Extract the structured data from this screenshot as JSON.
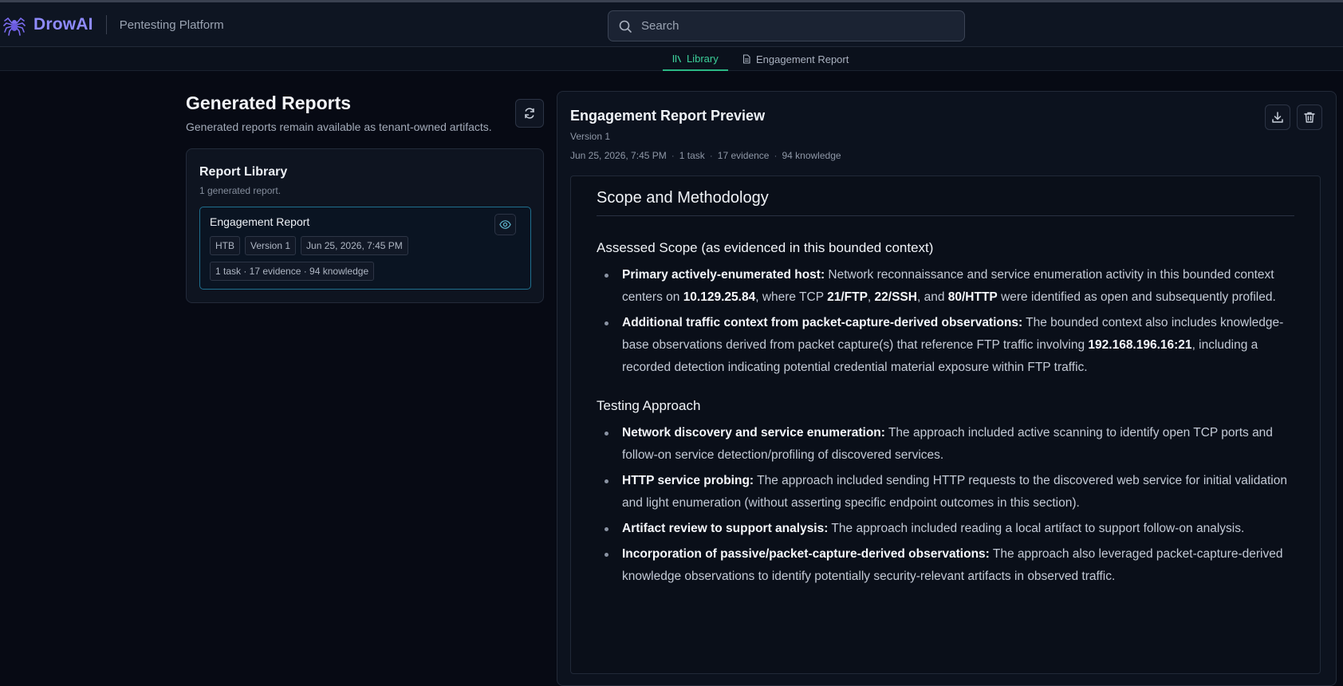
{
  "header": {
    "brand": "DrowAI",
    "subtitle": "Pentesting Platform",
    "search_placeholder": "Search"
  },
  "tabs": [
    {
      "label": "Library",
      "active": true
    },
    {
      "label": "Engagement Report",
      "active": false
    }
  ],
  "left": {
    "title": "Generated Reports",
    "subtitle": "Generated reports remain available as tenant-owned artifacts.",
    "library": {
      "title": "Report Library",
      "count": "1 generated report.",
      "report": {
        "title": "Engagement Report",
        "chips": [
          "HTB",
          "Version 1",
          "Jun 25, 2026, 7:45 PM"
        ],
        "summary": "1 task · 17 evidence · 94 knowledge"
      }
    }
  },
  "preview": {
    "title": "Engagement Report Preview",
    "version": "Version 1",
    "meta": [
      "Jun 25, 2026, 7:45 PM",
      "1 task",
      "17 evidence",
      "94 knowledge"
    ],
    "doc": {
      "h2": "Scope and Methodology",
      "s1": {
        "heading": "Assessed Scope (as evidenced in this bounded context)",
        "b1_lead": "Primary actively-enumerated host:",
        "b1_t1": " Network reconnaissance and service enumeration activity in this bounded context centers on ",
        "b1_ip": "10.129.25.84",
        "b1_t2": ", where TCP ",
        "b1_p1": "21/FTP",
        "b1_t3": ", ",
        "b1_p2": "22/SSH",
        "b1_t4": ", and ",
        "b1_p3": "80/HTTP",
        "b1_t5": " were identified as open and subsequently profiled.",
        "b2_lead": "Additional traffic context from packet-capture-derived observations:",
        "b2_t1": " The bounded context also includes knowledge-base observations derived from packet capture(s) that reference FTP traffic involving ",
        "b2_ip": "192.168.196.16:21",
        "b2_t2": ", including a recorded detection indicating potential credential material exposure within FTP traffic."
      },
      "s2": {
        "heading": "Testing Approach",
        "items": [
          {
            "lead": "Network discovery and service enumeration:",
            "text": " The approach included active scanning to identify open TCP ports and follow-on service detection/profiling of discovered services."
          },
          {
            "lead": "HTTP service probing:",
            "text": " The approach included sending HTTP requests to the discovered web service for initial validation and light enumeration (without asserting specific endpoint outcomes in this section)."
          },
          {
            "lead": "Artifact review to support analysis:",
            "text": " The approach included reading a local artifact to support follow-on analysis."
          },
          {
            "lead": "Incorporation of passive/packet-capture-derived observations:",
            "text": " The approach also leveraged packet-capture-derived knowledge observations to identify potentially security-relevant artifacts in observed traffic."
          }
        ]
      }
    }
  },
  "colors": {
    "accent": "#8f8bff",
    "tab_active": "#3ccf9a",
    "card_border": "#1f6f8e"
  }
}
